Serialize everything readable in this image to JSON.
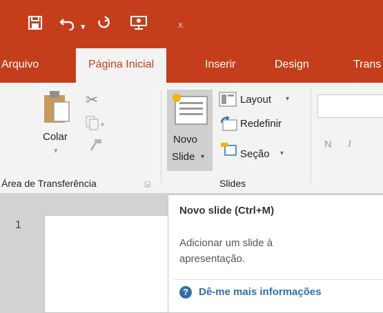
{
  "quick_access": {
    "icons": [
      "save-icon",
      "undo-icon",
      "redo-icon",
      "start-from-beginning-icon",
      "customize-qat-icon"
    ]
  },
  "tabs": [
    {
      "label": "Arquivo",
      "active": false
    },
    {
      "label": "Página Inicial",
      "active": true
    },
    {
      "label": "Inserir",
      "active": false
    },
    {
      "label": "Design",
      "active": false
    },
    {
      "label": "Trans",
      "active": false
    }
  ],
  "ribbon": {
    "clipboard": {
      "paste_label": "Colar",
      "group_label": "Área de Transferência",
      "icons": [
        "paste-icon",
        "cut-icon",
        "copy-icon",
        "format-painter-icon",
        "dialog-launcher-icon"
      ]
    },
    "slides": {
      "new_slide_label_1": "Novo",
      "new_slide_label_2": "Slide",
      "layout_label": "Layout",
      "reset_label": "Redefinir",
      "section_label": "Seção",
      "group_label": "Slides",
      "icons": [
        "new-slide-icon",
        "layout-icon",
        "reset-icon",
        "section-icon"
      ]
    },
    "font": {
      "bold_label": "N",
      "italic_label": "I"
    }
  },
  "slide_pane": {
    "slide_number": "1"
  },
  "tooltip": {
    "title": "Novo slide (Ctrl+M)",
    "description": "Adicionar um slide à apresentação.",
    "help_label": "Dê-me mais informações",
    "help_icon": "help-icon"
  },
  "colors": {
    "ribbon_accent": "#c43e1c",
    "ribbon_background": "#f3f3f3",
    "link_blue": "#2e6faa"
  }
}
